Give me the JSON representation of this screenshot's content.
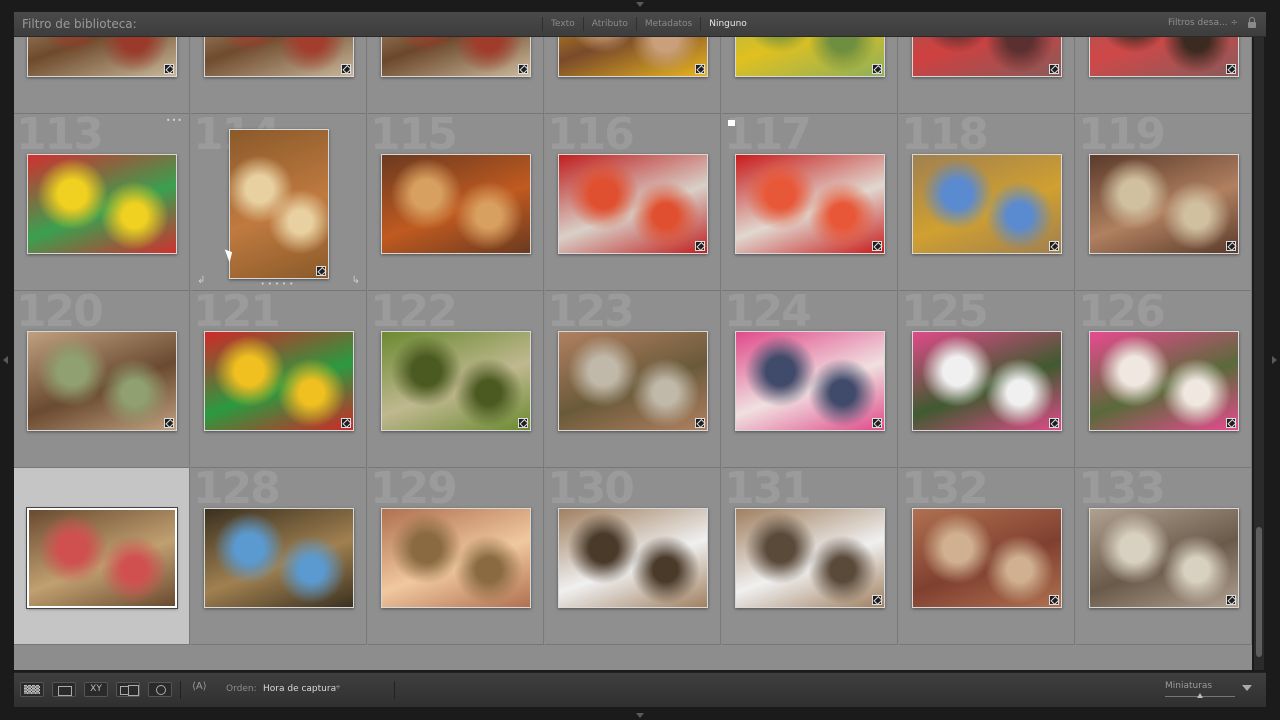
{
  "filter_bar": {
    "title": "Filtro de biblioteca:",
    "tabs": [
      {
        "label": "Texto",
        "active": false
      },
      {
        "label": "Atributo",
        "active": false
      },
      {
        "label": "Metadatos",
        "active": false
      },
      {
        "label": "Ninguno",
        "active": true
      }
    ],
    "preset_label": "Filtros desa... ÷"
  },
  "grid": {
    "rows": [
      {
        "cells": [
          {
            "number": "",
            "colors": [
              "#c9b89a",
              "#6e4a2c",
              "#9a3a2a"
            ],
            "orientation": "landscape",
            "badge": true
          },
          {
            "number": "",
            "colors": [
              "#c8b79a",
              "#704b2e",
              "#a33e2e"
            ],
            "orientation": "landscape",
            "badge": true
          },
          {
            "number": "",
            "colors": [
              "#cdbb9e",
              "#6b472a",
              "#a03c2c"
            ],
            "orientation": "landscape",
            "badge": true
          },
          {
            "number": "",
            "colors": [
              "#e8b420",
              "#7a4a2a",
              "#c9a07a"
            ],
            "orientation": "landscape",
            "badge": true
          },
          {
            "number": "",
            "colors": [
              "#8fb05a",
              "#e0c020",
              "#6e8e40"
            ],
            "orientation": "landscape",
            "badge": true
          },
          {
            "number": "",
            "colors": [
              "#8a5a5a",
              "#d04040",
              "#5a3030"
            ],
            "orientation": "landscape",
            "badge": true
          },
          {
            "number": "",
            "colors": [
              "#8a5a5a",
              "#d04848",
              "#3a2a20"
            ],
            "orientation": "landscape",
            "badge": true
          }
        ]
      },
      {
        "cells": [
          {
            "number": "113",
            "colors": [
              "#d03030",
              "#3aa050",
              "#f0d020"
            ],
            "orientation": "landscape",
            "badge": false,
            "dots": true
          },
          {
            "number": "114",
            "colors": [
              "#8a5a2a",
              "#c07a40",
              "#e8d0a0"
            ],
            "orientation": "portrait",
            "badge": true,
            "hovered": true
          },
          {
            "number": "115",
            "colors": [
              "#6a3a20",
              "#c05a20",
              "#d8a060"
            ],
            "orientation": "landscape",
            "badge": false
          },
          {
            "number": "116",
            "colors": [
              "#c02020",
              "#d8d0c8",
              "#e05030"
            ],
            "orientation": "landscape",
            "badge": true
          },
          {
            "number": "117",
            "colors": [
              "#c81c1c",
              "#e0d8d0",
              "#e85838"
            ],
            "orientation": "landscape",
            "badge": true,
            "flag": true
          },
          {
            "number": "118",
            "colors": [
              "#a08050",
              "#d0a030",
              "#5a8ad0"
            ],
            "orientation": "landscape",
            "badge": true
          },
          {
            "number": "119",
            "colors": [
              "#5a3a2a",
              "#b08060",
              "#d0c0a0"
            ],
            "orientation": "landscape",
            "badge": true
          }
        ]
      },
      {
        "cells": [
          {
            "number": "120",
            "colors": [
              "#c0a080",
              "#6a4a30",
              "#90a070"
            ],
            "orientation": "landscape",
            "badge": true
          },
          {
            "number": "121",
            "colors": [
              "#d02828",
              "#2a9a40",
              "#f0c020"
            ],
            "orientation": "landscape",
            "badge": true
          },
          {
            "number": "122",
            "colors": [
              "#6a8a30",
              "#c0b890",
              "#4a5a20"
            ],
            "orientation": "landscape",
            "badge": true
          },
          {
            "number": "123",
            "colors": [
              "#b08060",
              "#6a5a3a",
              "#c0b8a8"
            ],
            "orientation": "landscape",
            "badge": true
          },
          {
            "number": "124",
            "colors": [
              "#e04a8a",
              "#f0e0e0",
              "#404a6a"
            ],
            "orientation": "landscape",
            "badge": true
          },
          {
            "number": "125",
            "colors": [
              "#e04a8a",
              "#405a30",
              "#f0f0f0"
            ],
            "orientation": "landscape",
            "badge": true
          },
          {
            "number": "126",
            "colors": [
              "#e84a90",
              "#5a6a3a",
              "#f0e8e0"
            ],
            "orientation": "landscape",
            "badge": true
          }
        ]
      },
      {
        "cells": [
          {
            "number": "",
            "colors": [
              "#6a4a30",
              "#c0a070",
              "#d05050"
            ],
            "orientation": "landscape",
            "badge": false,
            "selected": true
          },
          {
            "number": "128",
            "colors": [
              "#3a3020",
              "#a08050",
              "#5a9ad0"
            ],
            "orientation": "landscape",
            "badge": false
          },
          {
            "number": "129",
            "colors": [
              "#b07050",
              "#f0c8a0",
              "#8a6a40"
            ],
            "orientation": "landscape",
            "badge": false
          },
          {
            "number": "130",
            "colors": [
              "#a08060",
              "#f0f0f0",
              "#4a3a2a"
            ],
            "orientation": "landscape",
            "badge": false
          },
          {
            "number": "131",
            "colors": [
              "#a08060",
              "#f0f0f0",
              "#5a4a3a"
            ],
            "orientation": "landscape",
            "badge": true
          },
          {
            "number": "132",
            "colors": [
              "#b07050",
              "#804030",
              "#d0b090"
            ],
            "orientation": "landscape",
            "badge": true
          },
          {
            "number": "133",
            "colors": [
              "#b0a090",
              "#6a5a4a",
              "#d8d0c0"
            ],
            "orientation": "landscape",
            "badge": true
          }
        ]
      }
    ]
  },
  "toolbar": {
    "compare_icon_text": "XY",
    "sort_label": "Orden:",
    "sort_value": "Hora de captura",
    "sort_caret": "÷",
    "sort_icon_text": "⟨A⟩",
    "thumbnail_label": "Miniaturas",
    "thumbnail_size": 0.5
  }
}
